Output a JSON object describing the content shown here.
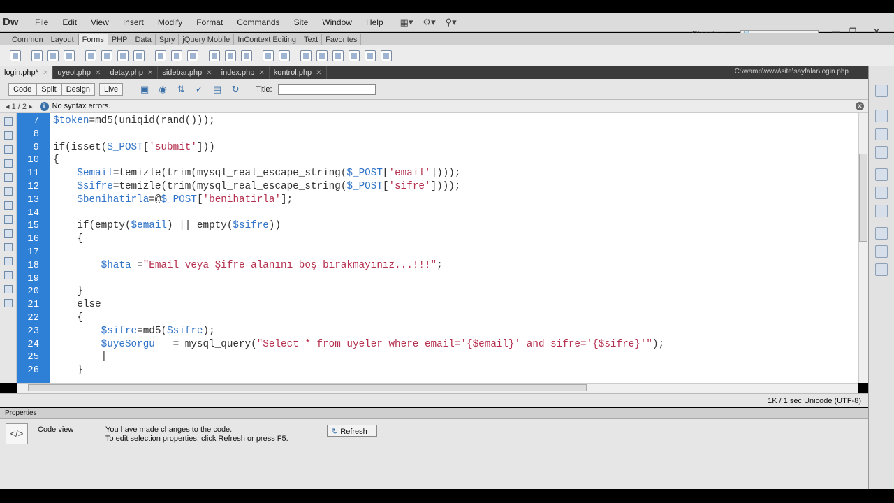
{
  "app": {
    "logo": "Dw"
  },
  "menu": [
    "File",
    "Edit",
    "View",
    "Insert",
    "Modify",
    "Format",
    "Commands",
    "Site",
    "Window",
    "Help"
  ],
  "workspace": {
    "label": "Classic",
    "arrow": "▾"
  },
  "search": {
    "placeholder": "🔍"
  },
  "insert_tabs": [
    "Common",
    "Layout",
    "Forms",
    "PHP",
    "Data",
    "Spry",
    "jQuery Mobile",
    "InContext Editing",
    "Text",
    "Favorites"
  ],
  "insert_active": "Forms",
  "doc_tabs": [
    {
      "label": "login.php*",
      "active": true
    },
    {
      "label": "uyeol.php",
      "active": false
    },
    {
      "label": "detay.php",
      "active": false
    },
    {
      "label": "sidebar.php",
      "active": false
    },
    {
      "label": "index.php",
      "active": false
    },
    {
      "label": "kontrol.php",
      "active": false
    }
  ],
  "doc_path": "C:\\wamp\\www\\site\\sayfalar\\login.php",
  "view_buttons": [
    "Code",
    "Split",
    "Design",
    "Live"
  ],
  "title_label": "Title:",
  "title_value": "",
  "info": {
    "nav": "◂   1 / 2  ▸",
    "message": "No syntax errors."
  },
  "line_numbers": [
    "7",
    "8",
    "9",
    "10",
    "11",
    "12",
    "13",
    "14",
    "15",
    "16",
    "17",
    "18",
    "19",
    "20",
    "21",
    "22",
    "23",
    "24",
    "25",
    "26"
  ],
  "status": "1K / 1 sec  Unicode (UTF-8)",
  "properties": {
    "header": "Properties",
    "view_label": "Code view",
    "message_line1": "You have made changes to the code.",
    "message_line2": "To edit selection properties, click Refresh or press F5.",
    "refresh_label": "Refresh"
  },
  "colors": {
    "gutter": "#2e7fd6",
    "variable": "#3275c8",
    "string": "#b5304e"
  }
}
